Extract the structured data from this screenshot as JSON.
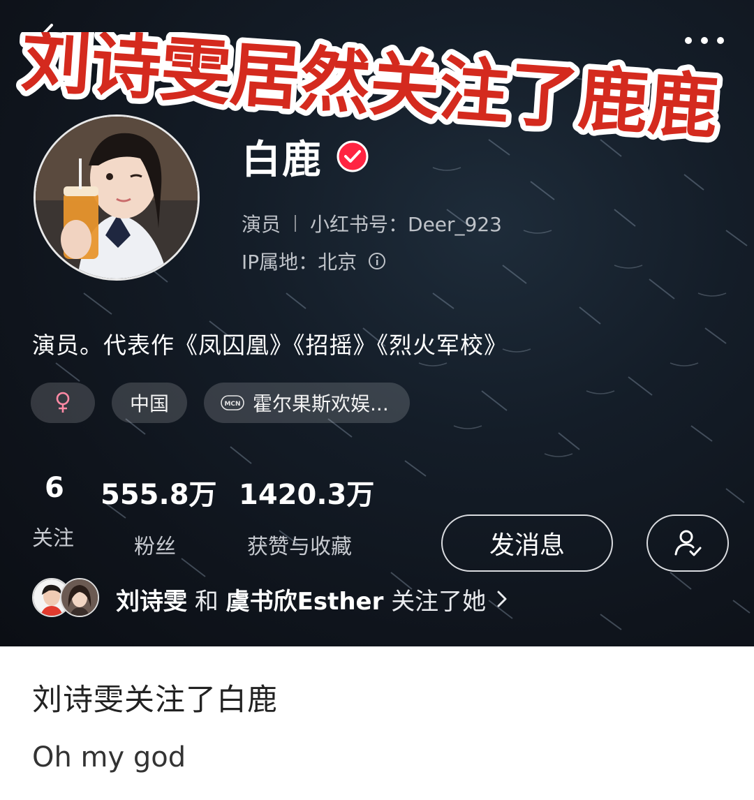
{
  "overlay_caption": "刘诗雯居然关注了鹿鹿",
  "profile": {
    "name": "白鹿",
    "occupation": "演员",
    "account_id": "小红书号：Deer_923",
    "ip_location": "IP属地：北京",
    "bio": "演员。代表作《凤囚凰》《招摇》《烈火军校》",
    "tags": {
      "gender_icon": "female-icon",
      "country": "中国",
      "mcn": "霍尔果斯欢娱..."
    },
    "stats": [
      {
        "value": "6",
        "label": "关注"
      },
      {
        "value": "555.8万",
        "label": "粉丝"
      },
      {
        "value": "1420.3万",
        "label": "获赞与收藏"
      }
    ],
    "message_button": "发消息",
    "mutual": {
      "user1": "刘诗雯",
      "conj": "和",
      "user2": "虞书欣Esther",
      "suffix": "关注了她"
    }
  },
  "post": {
    "title": "刘诗雯关注了白鹿",
    "body": "Oh my god"
  },
  "colors": {
    "verified_red": "#ff2442",
    "caption_red": "#d42a1e",
    "profile_bg": "#141d28"
  }
}
